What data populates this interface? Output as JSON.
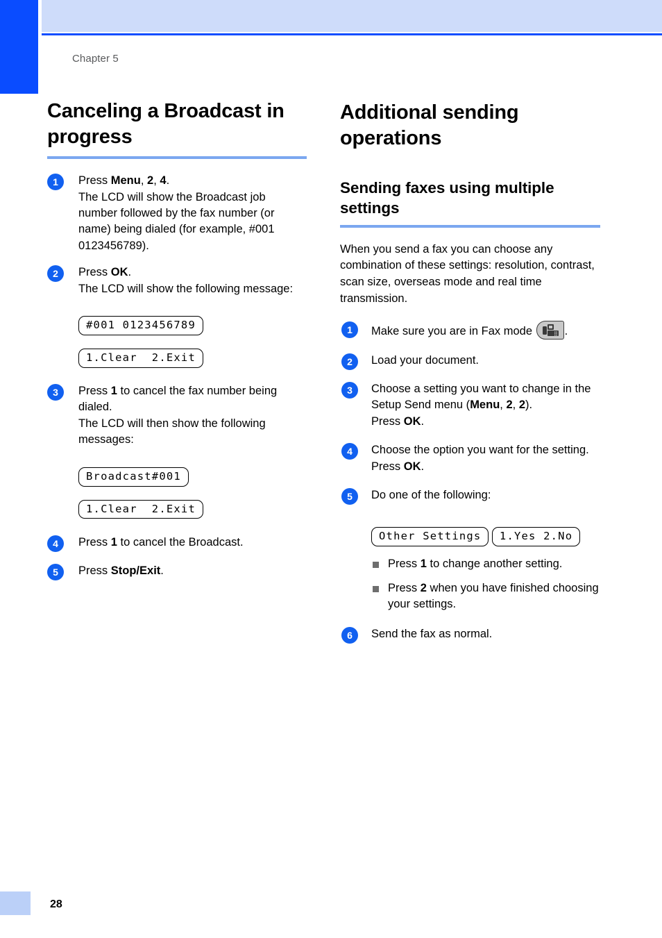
{
  "page": {
    "chapter_label": "Chapter 5",
    "page_number": "28"
  },
  "left_column": {
    "heading": "Canceling a Broadcast in progress",
    "steps": [
      {
        "number": "1",
        "text_html": "Press <b>Menu</b>, <b>2</b>, <b>4</b>.<br>The LCD will show the Broadcast job number followed by the fax number (or name) being dialed (for example, #001 0123456789)."
      },
      {
        "number": "2",
        "text_html": "Press <b>OK</b>.<br>The LCD will show the following message:"
      },
      {
        "number": "3",
        "text_html": "Press <b>1</b> to cancel the fax number being dialed.<br>The LCD will then show the following messages:"
      },
      {
        "number": "4",
        "text_html": "Press <b>1</b> to cancel the Broadcast."
      },
      {
        "number": "5",
        "text_html": "Press <b>Stop/Exit</b>."
      }
    ],
    "lcd_group_1": [
      "#001 0123456789",
      "1.Clear  2.Exit"
    ],
    "lcd_group_2": [
      "Broadcast#001",
      "1.Clear  2.Exit"
    ]
  },
  "right_column": {
    "heading": "Additional sending operations",
    "subheading": "Sending faxes using multiple settings",
    "intro": "When you send a fax you can choose any combination of these settings: resolution, contrast, scan size, overseas mode and real time transmission.",
    "steps": [
      {
        "number": "1",
        "text_html": "Make sure you are in Fax mode ",
        "has_fax_icon": true,
        "text_after": "."
      },
      {
        "number": "2",
        "text_html": "Load your document."
      },
      {
        "number": "3",
        "text_html": "Choose a setting you want to change in the Setup Send menu (<b>Menu</b>, <b>2</b>, <b>2</b>).<br>Press <b>OK</b>."
      },
      {
        "number": "4",
        "text_html": "Choose the option you want for the setting.<br>Press <b>OK</b>."
      },
      {
        "number": "5",
        "text_html": "Do one of the following:"
      },
      {
        "number": "6",
        "text_html": "Send the fax as normal."
      }
    ],
    "lcd_group_1": [
      "Other Settings",
      "1.Yes 2.No"
    ],
    "bullets": [
      "Press <b>1</b> to change another setting.",
      "Press <b>2</b> when you have finished choosing your settings."
    ]
  },
  "colors": {
    "tab_blue": "#0A4CFF",
    "header_band": "#CEDCFA",
    "rule_blue": "#7BA7F0",
    "badge_blue": "#1160F0",
    "footer_block": "#BBD0F8",
    "bullet_gray": "#6E6E6E",
    "fax_icon_bg": "#C9C9C9"
  }
}
